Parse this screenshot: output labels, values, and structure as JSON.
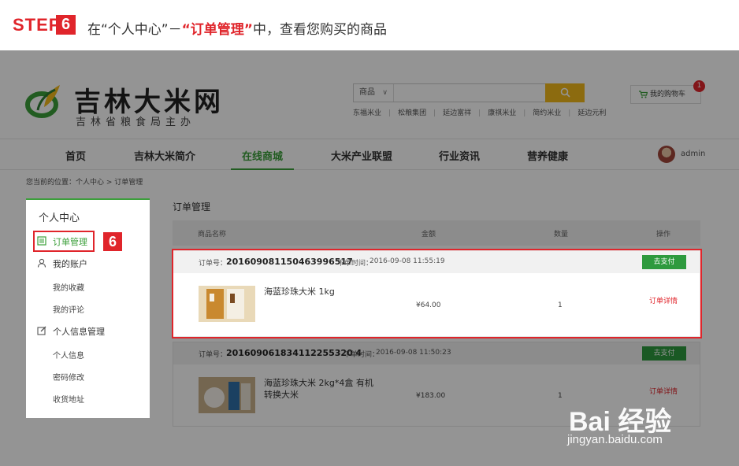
{
  "banner": {
    "step_word": "STEP",
    "step_num": "6",
    "text_a": "在“个人中心”－",
    "text_hl": "“订单管理”",
    "text_b": "中，查看您购买的商品"
  },
  "header": {
    "logo_text": "吉林大米网",
    "logo_sub": "吉林省粮食局主办",
    "search_category": "商品",
    "hot_links": [
      "东福米业",
      "松粮集团",
      "延边富祥",
      "康祺米业",
      "简约米业",
      "延边元利"
    ],
    "cart_label": "我的购物车",
    "cart_count": "1"
  },
  "nav": {
    "items": [
      "首页",
      "吉林大米简介",
      "在线商城",
      "大米产业联盟",
      "行业资讯",
      "营养健康"
    ],
    "user": "admin"
  },
  "breadcrumb": "您当前的位置：个人中心 > 订单管理",
  "sidebar": {
    "title": "个人中心",
    "orders": "订单管理",
    "account": "我的账户",
    "favorites": "我的收藏",
    "reviews": "我的评论",
    "info_mgmt": "个人信息管理",
    "info": "个人信息",
    "password": "密码修改",
    "address": "收货地址",
    "step_badge": "6"
  },
  "main": {
    "title": "订单管理",
    "columns": [
      "商品名称",
      "金额",
      "数量",
      "操作"
    ],
    "orders": [
      {
        "no_label": "订单号：",
        "no": "201609081150463996517",
        "time_label": "下单时间：",
        "time": "2016-09-08 11:55:19",
        "pay": "去支付",
        "product": "海蓝珍珠大米 1kg",
        "price": "¥64.00",
        "qty": "1",
        "detail": "订单详情"
      },
      {
        "no_label": "订单号：",
        "no": "201609061834112255320 4",
        "time_label": "下单时间：",
        "time": "2016-09-08 11:50:23",
        "pay": "去支付",
        "product_line1": "海蓝珍珠大米 2kg*4盒 有机",
        "product_line2": "转换大米",
        "price": "¥183.00",
        "qty": "1",
        "detail": "订单详情"
      }
    ]
  },
  "watermark": {
    "logo": "Bai  经验",
    "url": "jingyan.baidu.com"
  },
  "colors": {
    "accent_red": "#e0252b",
    "brand_green": "#3b9f3a",
    "pay_green": "#2e9a3e",
    "search_yellow": "#f2b81a"
  }
}
